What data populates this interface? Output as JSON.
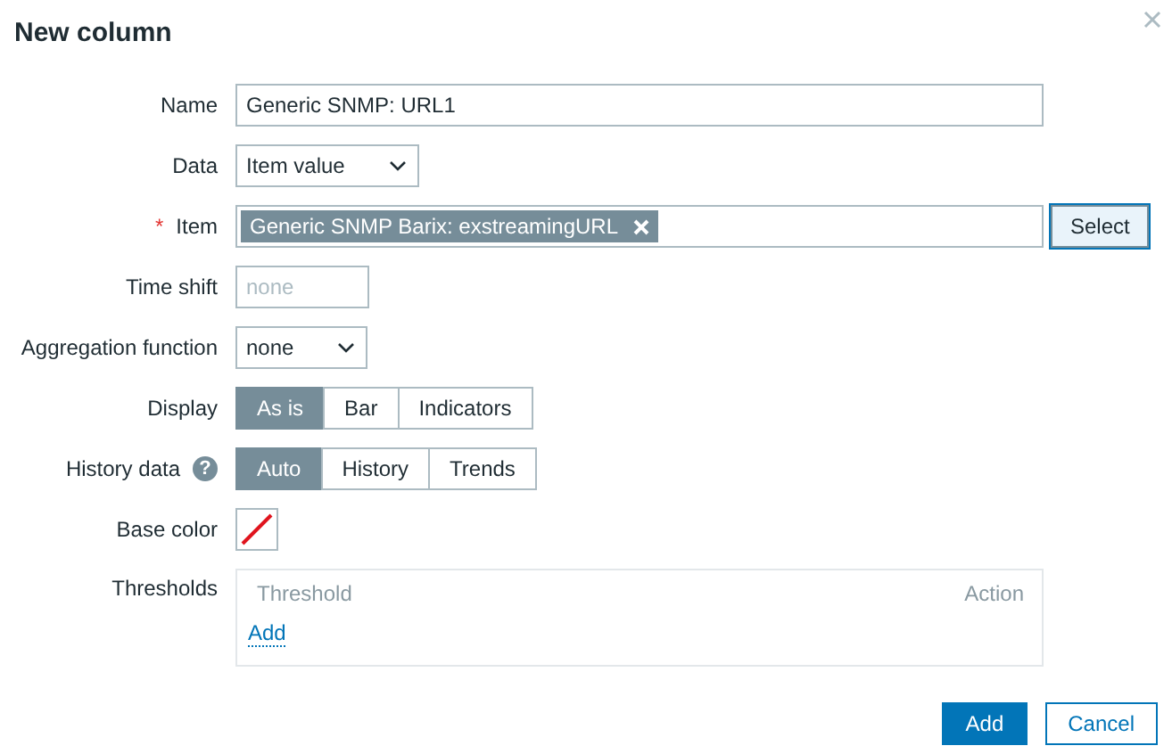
{
  "dialog": {
    "title": "New column"
  },
  "fields": [
    {
      "kind": "text",
      "label": "Name",
      "value": "Generic SNMP: URL1"
    },
    {
      "kind": "select",
      "label": "Data",
      "value": "Item value"
    },
    {
      "kind": "multiselect",
      "label": "Item",
      "required_mark": "*",
      "tags": [
        "Generic SNMP Barix: exstreamingURL"
      ],
      "button": "Select"
    },
    {
      "kind": "short-text",
      "label": "Time shift",
      "placeholder": "none"
    },
    {
      "kind": "select",
      "label": "Aggregation function",
      "value": "none"
    },
    {
      "kind": "segmented",
      "label": "Display",
      "options": [
        {
          "label": "As is",
          "selected": true
        },
        {
          "label": "Bar",
          "selected": false
        },
        {
          "label": "Indicators",
          "selected": false
        }
      ]
    },
    {
      "kind": "segmented",
      "label": "History data",
      "help": "?",
      "options": [
        {
          "label": "Auto",
          "selected": true
        },
        {
          "label": "History",
          "selected": false
        },
        {
          "label": "Trends",
          "selected": false
        }
      ]
    },
    {
      "kind": "color",
      "label": "Base color"
    },
    {
      "kind": "thresholds",
      "label": "Thresholds",
      "columns": [
        "Threshold",
        "Action"
      ],
      "add_link": "Add"
    }
  ],
  "footer": {
    "buttons": [
      {
        "label": "Add",
        "kind": "primary"
      },
      {
        "label": "Cancel",
        "kind": "secondary"
      }
    ]
  }
}
